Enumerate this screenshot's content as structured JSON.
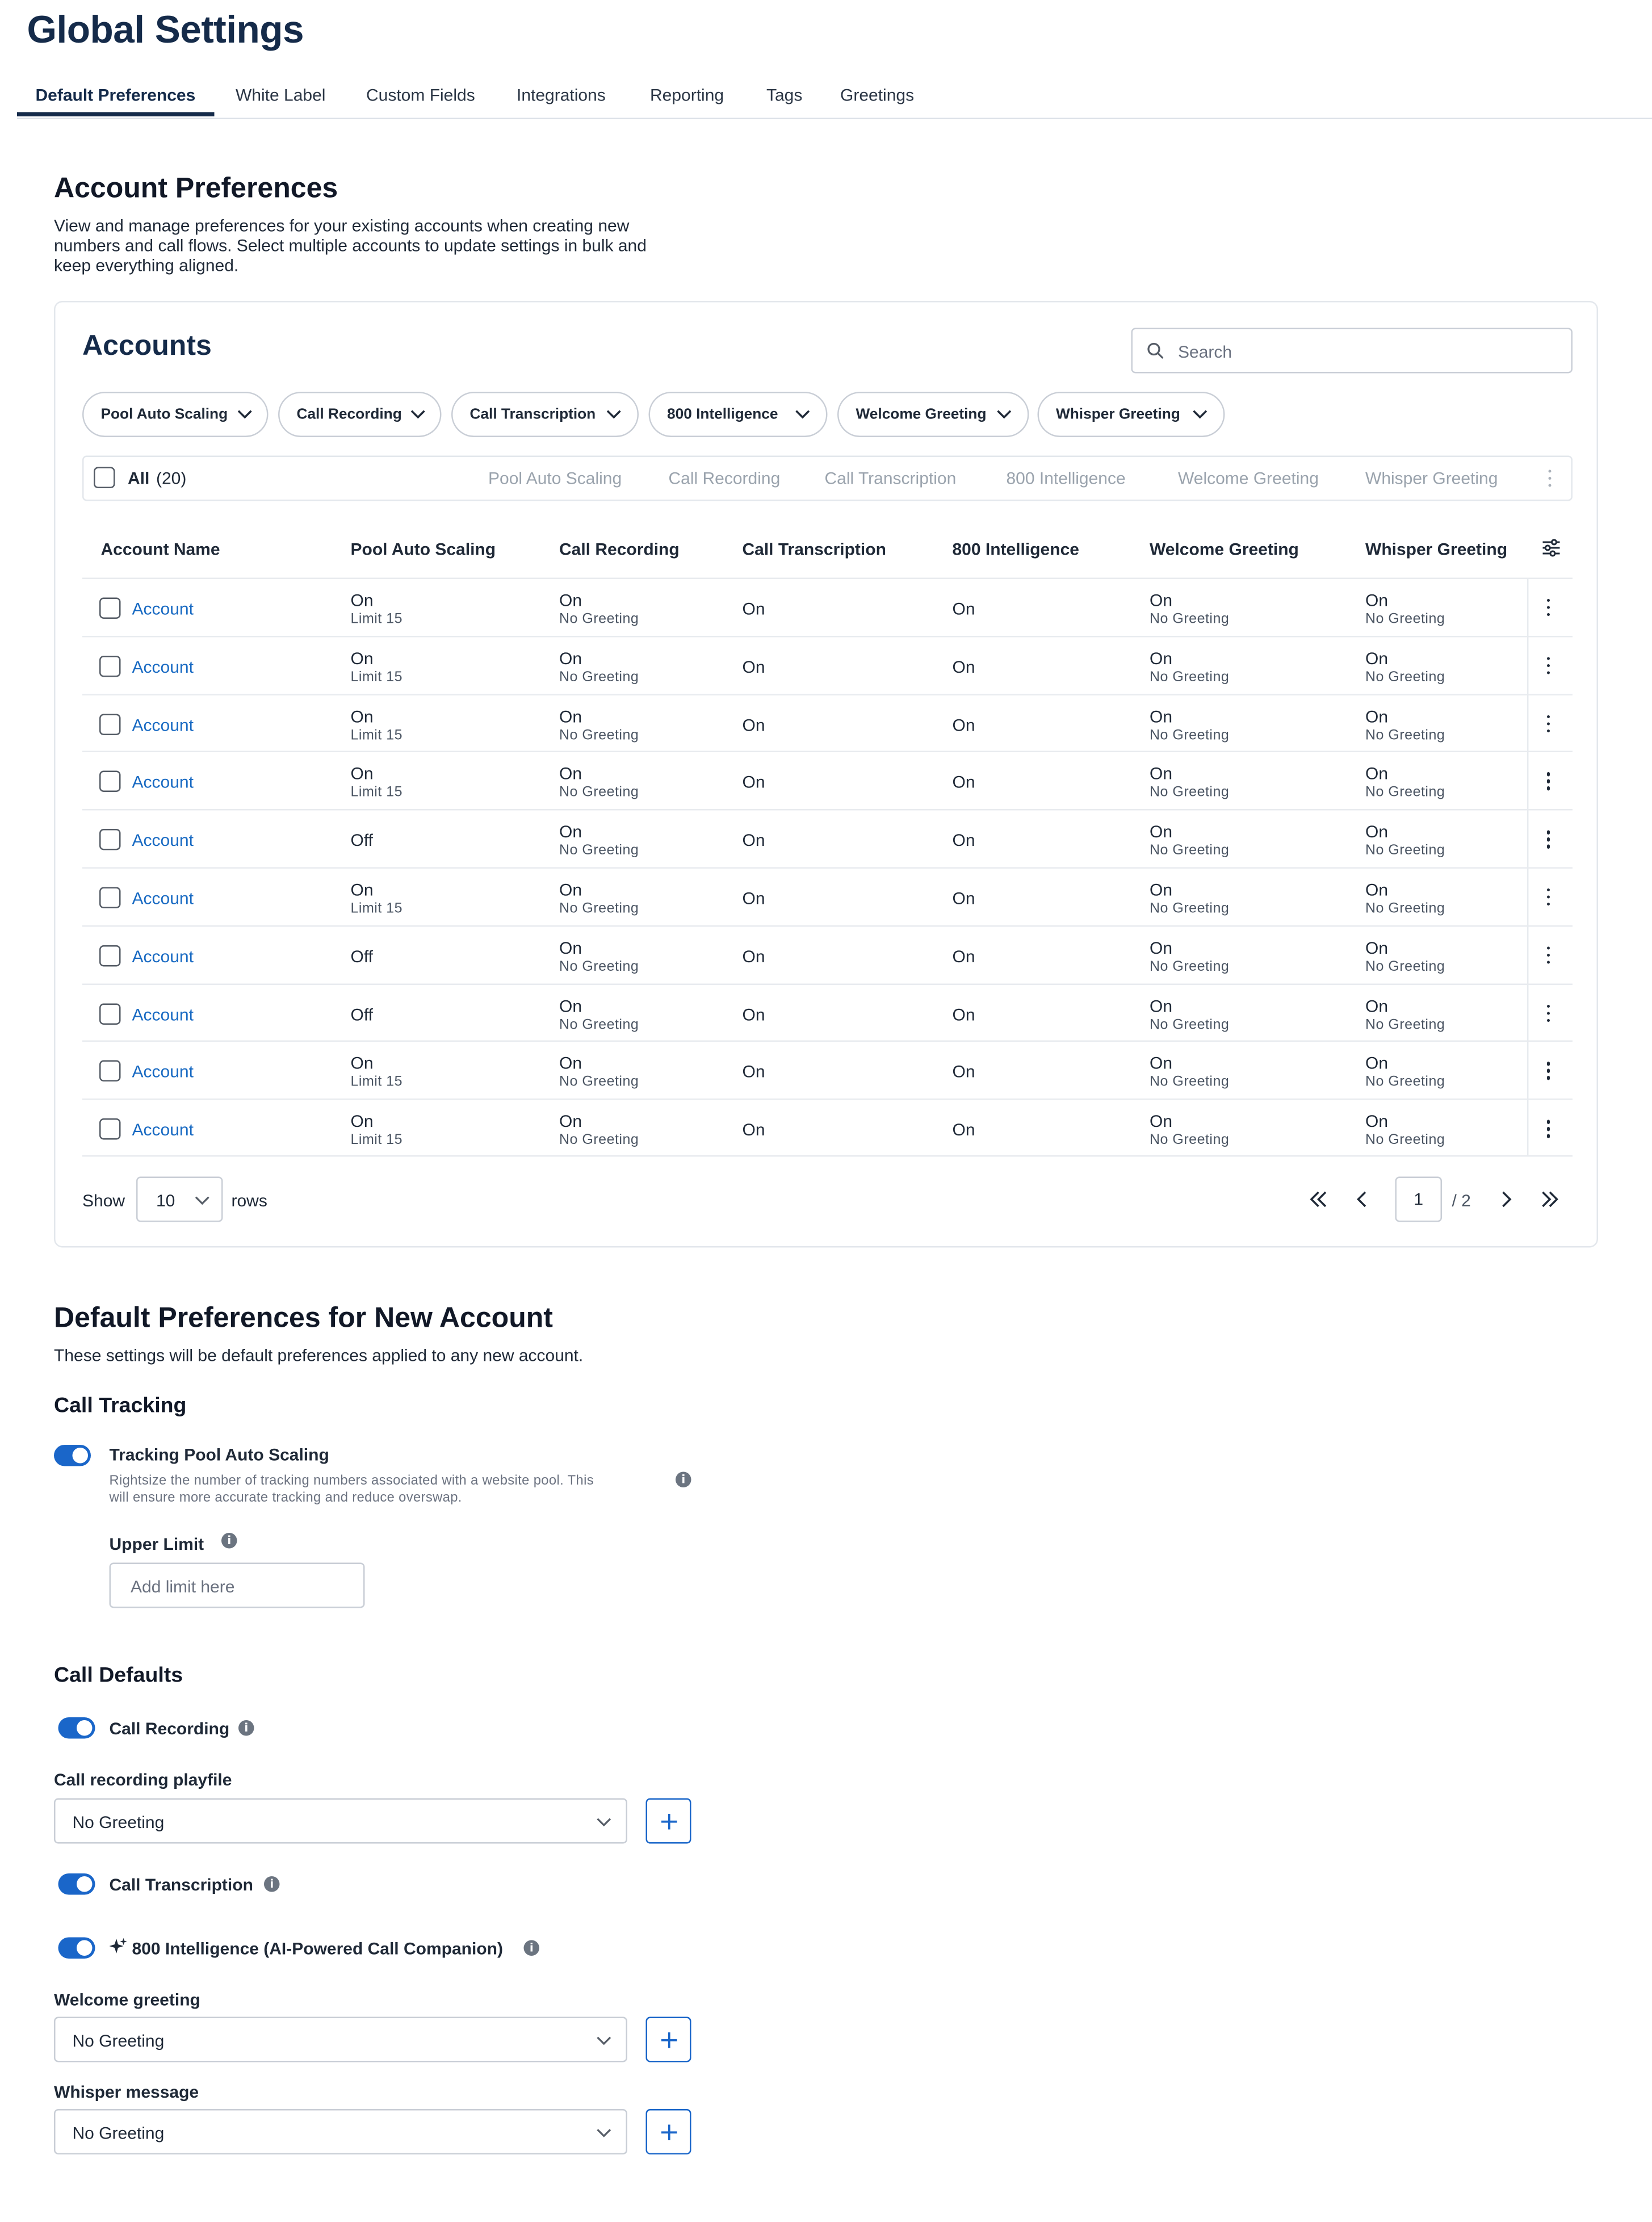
{
  "page_title": "Global Settings",
  "tabs": [
    {
      "label": "Default Preferences",
      "active": true
    },
    {
      "label": "White Label"
    },
    {
      "label": "Custom Fields"
    },
    {
      "label": "Integrations"
    },
    {
      "label": "Reporting"
    },
    {
      "label": "Tags"
    },
    {
      "label": "Greetings"
    }
  ],
  "account_preferences": {
    "title": "Account Preferences",
    "description": "View and manage preferences for your existing accounts when creating new numbers and call flows. Select multiple accounts to update settings in bulk and keep everything aligned."
  },
  "accounts": {
    "title": "Accounts",
    "search_placeholder": "Search",
    "filters": [
      "Pool Auto Scaling",
      "Call Recording",
      "Call Transcription",
      "800 Intelligence",
      "Welcome Greeting",
      "Whisper Greeting"
    ],
    "bulk": {
      "all_label": "All",
      "count_label": "(20)",
      "actions": [
        "Pool Auto Scaling",
        "Call Recording",
        "Call Transcription",
        "800 Intelligence",
        "Welcome Greeting",
        "Whisper Greeting"
      ]
    },
    "columns": [
      "Account Name",
      "Pool Auto Scaling",
      "Call Recording",
      "Call Transcription",
      "800 Intelligence",
      "Welcome Greeting",
      "Whisper Greeting"
    ],
    "rows": [
      {
        "name": "Account",
        "pool": "On",
        "pool_sub": "Limit 15",
        "rec": "On",
        "rec_sub": "No Greeting",
        "trans": "On",
        "intel": "On",
        "welcome": "On",
        "welcome_sub": "No Greeting",
        "whisper": "On",
        "whisper_sub": "No Greeting"
      },
      {
        "name": "Account",
        "pool": "On",
        "pool_sub": "Limit 15",
        "rec": "On",
        "rec_sub": "No Greeting",
        "trans": "On",
        "intel": "On",
        "welcome": "On",
        "welcome_sub": "No Greeting",
        "whisper": "On",
        "whisper_sub": "No Greeting"
      },
      {
        "name": "Account",
        "pool": "On",
        "pool_sub": "Limit 15",
        "rec": "On",
        "rec_sub": "No Greeting",
        "trans": "On",
        "intel": "On",
        "welcome": "On",
        "welcome_sub": "No Greeting",
        "whisper": "On",
        "whisper_sub": "No Greeting"
      },
      {
        "name": "Account",
        "pool": "On",
        "pool_sub": "Limit 15",
        "rec": "On",
        "rec_sub": "No Greeting",
        "trans": "On",
        "intel": "On",
        "welcome": "On",
        "welcome_sub": "No Greeting",
        "whisper": "On",
        "whisper_sub": "No Greeting"
      },
      {
        "name": "Account",
        "pool": "Off",
        "pool_sub": "",
        "rec": "On",
        "rec_sub": "No Greeting",
        "trans": "On",
        "intel": "On",
        "welcome": "On",
        "welcome_sub": "No Greeting",
        "whisper": "On",
        "whisper_sub": "No Greeting"
      },
      {
        "name": "Account",
        "pool": "On",
        "pool_sub": "Limit 15",
        "rec": "On",
        "rec_sub": "No Greeting",
        "trans": "On",
        "intel": "On",
        "welcome": "On",
        "welcome_sub": "No Greeting",
        "whisper": "On",
        "whisper_sub": "No Greeting"
      },
      {
        "name": "Account",
        "pool": "Off",
        "pool_sub": "",
        "rec": "On",
        "rec_sub": "No Greeting",
        "trans": "On",
        "intel": "On",
        "welcome": "On",
        "welcome_sub": "No Greeting",
        "whisper": "On",
        "whisper_sub": "No Greeting"
      },
      {
        "name": "Account",
        "pool": "Off",
        "pool_sub": "",
        "rec": "On",
        "rec_sub": "No Greeting",
        "trans": "On",
        "intel": "On",
        "welcome": "On",
        "welcome_sub": "No Greeting",
        "whisper": "On",
        "whisper_sub": "No Greeting"
      },
      {
        "name": "Account",
        "pool": "On",
        "pool_sub": "Limit 15",
        "rec": "On",
        "rec_sub": "No Greeting",
        "trans": "On",
        "intel": "On",
        "welcome": "On",
        "welcome_sub": "No Greeting",
        "whisper": "On",
        "whisper_sub": "No Greeting"
      },
      {
        "name": "Account",
        "pool": "On",
        "pool_sub": "Limit 15",
        "rec": "On",
        "rec_sub": "No Greeting",
        "trans": "On",
        "intel": "On",
        "welcome": "On",
        "welcome_sub": "No Greeting",
        "whisper": "On",
        "whisper_sub": "No Greeting"
      }
    ],
    "pagination": {
      "show_label": "Show",
      "rows_value": "10",
      "rows_label": "rows",
      "current_page": "1",
      "total_label": "/ 2"
    }
  },
  "defaults": {
    "title": "Default Preferences for New Account",
    "description": "These settings will be default preferences applied to any new account.",
    "call_tracking": {
      "title": "Call Tracking",
      "pool_toggle_label": "Tracking Pool Auto Scaling",
      "pool_toggle_on": true,
      "pool_desc_line1": "Rightsize the number of tracking numbers associated with a website pool. This",
      "pool_desc_line2": "will ensure more accurate tracking and reduce overswap.",
      "upper_limit_label": "Upper Limit",
      "upper_limit_placeholder": "Add limit here"
    },
    "call_defaults": {
      "title": "Call Defaults",
      "recording_label": "Call Recording",
      "recording_on": true,
      "playfile_label": "Call recording playfile",
      "playfile_value": "No Greeting",
      "transcription_label": "Call Transcription",
      "transcription_on": true,
      "intelligence_label": "800 Intelligence (AI-Powered Call Companion)",
      "intelligence_on": true,
      "welcome_label": "Welcome greeting",
      "welcome_value": "No Greeting",
      "whisper_label": "Whisper message",
      "whisper_value": "No Greeting"
    }
  },
  "colors": {
    "primary": "#1a66c9",
    "heading": "#152b4a",
    "link": "#1769c2",
    "muted": "#9aa3ad"
  },
  "icons": [
    "search-icon",
    "chevron-down-icon",
    "kebab-icon",
    "sliders-icon",
    "first-page-icon",
    "prev-page-icon",
    "next-page-icon",
    "last-page-icon",
    "info-icon",
    "sparkle-icon",
    "plus-icon"
  ]
}
